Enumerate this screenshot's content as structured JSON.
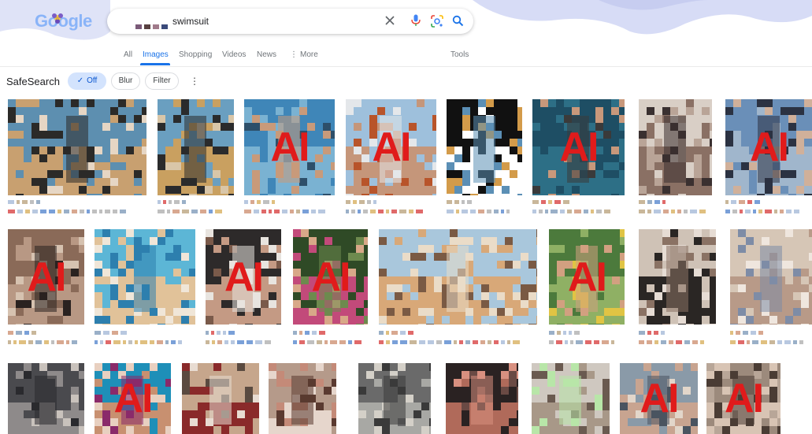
{
  "header": {
    "logo": "Google",
    "search": {
      "query": "swimsuit"
    },
    "tabs": [
      {
        "label": "All",
        "active": false
      },
      {
        "label": "Images",
        "active": true
      },
      {
        "label": "Shopping",
        "active": false
      },
      {
        "label": "Videos",
        "active": false
      },
      {
        "label": "News",
        "active": false
      },
      {
        "label": "More",
        "active": false
      }
    ],
    "tools_label": "Tools"
  },
  "safesearch": {
    "label": "SafeSearch",
    "options": [
      {
        "label": "Off",
        "selected": true
      },
      {
        "label": "Blur",
        "selected": false
      },
      {
        "label": "Filter",
        "selected": false
      }
    ]
  },
  "results": {
    "badge_text": "AI",
    "badge_color": "#e01b1b",
    "rows": [
      [
        {
          "ai": false,
          "palette": [
            "#5d8fb0",
            "#c8a070",
            "#2b2a28",
            "#e6d6c4"
          ]
        },
        {
          "ai": false,
          "palette": [
            "#6a9fc0",
            "#c9a060",
            "#2a2b2c",
            "#d9c6a8"
          ]
        },
        {
          "ai": true,
          "palette": [
            "#3f86b8",
            "#7ab2d2",
            "#c89a7a",
            "#2d4f6a"
          ]
        },
        {
          "ai": true,
          "palette": [
            "#9ec0dc",
            "#c5967a",
            "#e4e7ea",
            "#b8542a"
          ]
        },
        {
          "ai": false,
          "palette": [
            "#111111",
            "#ffffff",
            "#5b8fb5",
            "#d39b4a"
          ]
        },
        {
          "ai": true,
          "palette": [
            "#1e4e64",
            "#2d6f86",
            "#3a3a3a",
            "#c8987b"
          ]
        },
        {
          "ai": false,
          "palette": [
            "#d9cfc6",
            "#8a7064",
            "#3a3030",
            "#b9a497"
          ]
        },
        {
          "ai": true,
          "palette": [
            "#6a8fb8",
            "#a0b6cc",
            "#2b3242",
            "#d0b09a"
          ]
        }
      ],
      [
        {
          "ai": true,
          "palette": [
            "#8a6a58",
            "#b89884",
            "#2a2220",
            "#d6c2b0"
          ]
        },
        {
          "ai": false,
          "palette": [
            "#5cb6d6",
            "#e1c299",
            "#2d7fae",
            "#f0e6d8"
          ]
        },
        {
          "ai": true,
          "palette": [
            "#2d2a2a",
            "#c49a84",
            "#e8e4df",
            "#7a5a4a"
          ]
        },
        {
          "ai": true,
          "palette": [
            "#2f4a26",
            "#c24a7a",
            "#6e8a4e",
            "#d8a888"
          ]
        },
        {
          "ai": false,
          "palette": [
            "#a9c7dc",
            "#d8a878",
            "#eadcc8",
            "#7a5a44"
          ]
        },
        {
          "ai": true,
          "palette": [
            "#4c7a3c",
            "#8fb064",
            "#d2a080",
            "#e0c444"
          ]
        },
        {
          "ai": false,
          "palette": [
            "#cfc2b6",
            "#2a2624",
            "#8a7264",
            "#e6dcd4"
          ]
        },
        {
          "ai": false,
          "palette": [
            "#d6c6b6",
            "#b89a88",
            "#7e8ca6",
            "#efe6de"
          ]
        }
      ],
      [
        {
          "ai": false,
          "palette": [
            "#4a4a4e",
            "#8e8a8a",
            "#2a2a2e",
            "#c9c2bc"
          ]
        },
        {
          "ai": true,
          "palette": [
            "#1e8fb8",
            "#c89070",
            "#8a2a6a",
            "#e8d0c0"
          ]
        },
        {
          "ai": false,
          "palette": [
            "#c6a68c",
            "#8a2a2a",
            "#e8dcd2",
            "#5a4a40"
          ]
        },
        {
          "ai": false,
          "palette": [
            "#b59a8a",
            "#e6d6cc",
            "#5a3a30",
            "#c48a78"
          ]
        },
        {
          "ai": false,
          "palette": [
            "#6a6a6a",
            "#a8a8a4",
            "#3a3a3a",
            "#d4d0c8"
          ]
        },
        {
          "ai": false,
          "palette": [
            "#2a2222",
            "#b06a5a",
            "#d89080",
            "#6a4a44"
          ]
        },
        {
          "ai": false,
          "palette": [
            "#cfc8c0",
            "#a89888",
            "#b8e6a8",
            "#6a5a50"
          ]
        },
        {
          "ai": true,
          "palette": [
            "#8a9aa8",
            "#c8a490",
            "#4a5460",
            "#e2d6ca"
          ]
        },
        {
          "ai": true,
          "palette": [
            "#9c8a7c",
            "#d8c4b4",
            "#4a3c34",
            "#b8a698"
          ]
        }
      ]
    ]
  }
}
